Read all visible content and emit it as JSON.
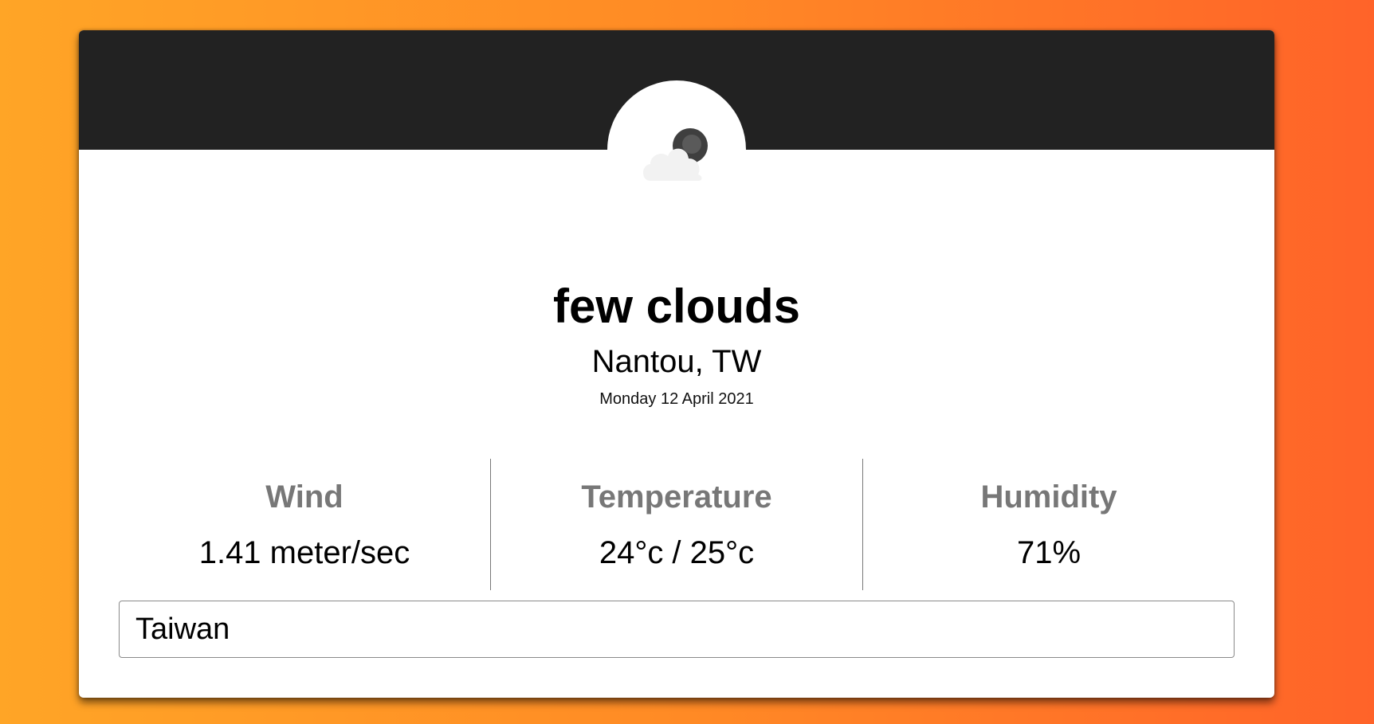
{
  "weather": {
    "icon": "few-clouds-night-icon",
    "description": "few clouds",
    "location": "Nantou, TW",
    "date": "Monday 12 April 2021"
  },
  "stats": {
    "wind": {
      "label": "Wind",
      "value": "1.41 meter/sec"
    },
    "temperature": {
      "label": "Temperature",
      "value": "24°c / 25°c"
    },
    "humidity": {
      "label": "Humidity",
      "value": "71%"
    }
  },
  "search": {
    "value": "Taiwan"
  },
  "colors": {
    "header": "#222222",
    "gradient_start": "#ffa526",
    "gradient_end": "#ff6329",
    "stat_label": "#777777"
  }
}
